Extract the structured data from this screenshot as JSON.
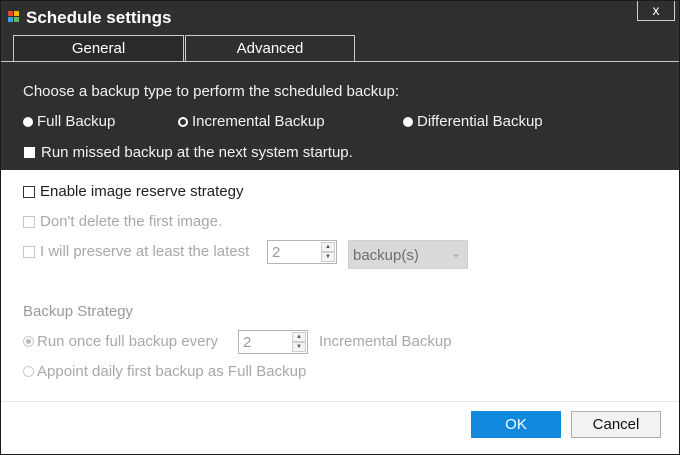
{
  "window": {
    "title": "Schedule settings",
    "close_label": "x"
  },
  "tabs": [
    {
      "label": "General",
      "active": false
    },
    {
      "label": "Advanced",
      "active": true
    }
  ],
  "backup_type": {
    "prompt": "Choose a backup type to perform the scheduled backup:",
    "options": [
      {
        "label": "Full Backup",
        "selected": true
      },
      {
        "label": "Incremental Backup",
        "selected": false
      },
      {
        "label": "Differential Backup",
        "selected": false
      }
    ],
    "run_missed": {
      "label": "Run missed backup at the next system startup.",
      "checked": true
    }
  },
  "reserve": {
    "enable_label": "Enable image reserve strategy",
    "enable_checked": false,
    "dont_delete_label": "Don't delete the first image.",
    "preserve_label": "I will preserve at least the latest",
    "preserve_value": "2",
    "unit_value": "backup(s)"
  },
  "strategy": {
    "heading": "Backup Strategy",
    "run_once_label": "Run once full backup every",
    "run_once_value": "2",
    "run_once_suffix": "Incremental Backup",
    "appoint_label": "Appoint daily first backup as Full Backup"
  },
  "footer": {
    "ok_label": "OK",
    "cancel_label": "Cancel"
  },
  "colors": {
    "accent": "#0f88dd",
    "dark_bg": "#2f2f2f"
  }
}
